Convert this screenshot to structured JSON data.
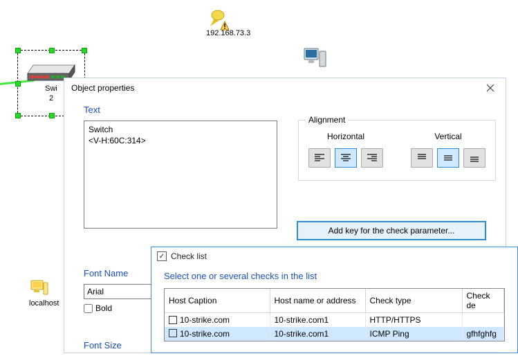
{
  "colors": {
    "accent": "#1a50b8",
    "sel": "#cfe8ff",
    "handle": "#2dd22d"
  },
  "background": {
    "pin_label": "192.168.73.3",
    "switch_label_1": "Swi",
    "switch_label_2": "2",
    "pc_label": "",
    "host_label": "localhost"
  },
  "dialog": {
    "title": "Object properties",
    "sections": {
      "text": "Text",
      "font_name": "Font Name",
      "font_size": "Font Size"
    },
    "text_value": "Switch\n<V-H:60C:314>",
    "alignment": {
      "title": "Alignment",
      "horizontal_label": "Horizontal",
      "vertical_label": "Vertical",
      "h_selected": 1,
      "v_selected": 1
    },
    "add_key_label": "Add key for the check parameter...",
    "font_value": "Arial",
    "bold_label": "Bold",
    "bold_checked": false
  },
  "check_list": {
    "title": "Check list",
    "subtitle": "Select one or several checks in the list",
    "columns": [
      "Host Caption",
      "Host name or address",
      "Check type",
      "Check de"
    ],
    "rows": [
      {
        "caption": "10-strike.com",
        "addr": "10-strike.com1",
        "type": "HTTP/HTTPS",
        "desc": "",
        "selected": false
      },
      {
        "caption": "10-strike.com",
        "addr": "10-strike.com1",
        "type": "ICMP Ping",
        "desc": "gfhfghfg",
        "selected": true
      }
    ]
  }
}
